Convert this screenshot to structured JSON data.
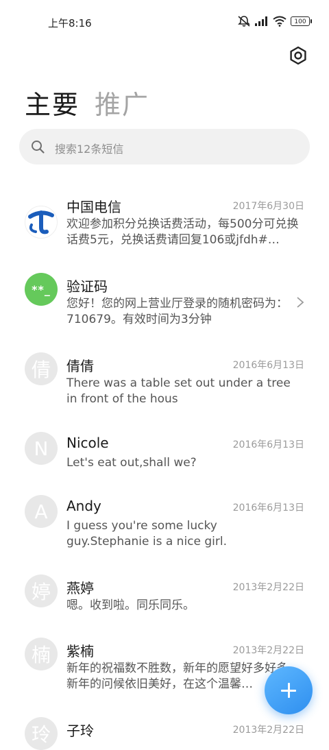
{
  "status": {
    "time": "上午8:16",
    "battery": "100"
  },
  "tabs": {
    "primary": "主要",
    "promotions": "推广"
  },
  "search": {
    "placeholder": "搜索12条短信"
  },
  "messages": [
    {
      "name": "中国电信",
      "date": "2017年6月30日",
      "preview": "欢迎参加积分兑换话费活动，每500分可兑换话费5元，兑换话费请回复106或jfdh#…",
      "avatar": "telecom-logo"
    },
    {
      "name": "验证码",
      "date": "",
      "preview": "您好！您的网上营业厅登录的随机密码为：710679。有效时间为3分钟",
      "avatar": "**_"
    },
    {
      "name": "倩倩",
      "date": "2016年6月13日",
      "preview": "There was a table set out under a tree in front of the hous",
      "avatar": "倩"
    },
    {
      "name": "Nicole",
      "date": "2016年6月13日",
      "preview": "Let's eat out,shall we?",
      "avatar": "N"
    },
    {
      "name": "Andy",
      "date": "2016年6月13日",
      "preview": "I guess you're some lucky guy.Stephanie is a nice girl.",
      "avatar": "A"
    },
    {
      "name": "燕婷",
      "date": "2013年2月22日",
      "preview": "嗯。收到啦。同乐同乐。",
      "avatar": "婷"
    },
    {
      "name": "紫楠",
      "date": "2013年2月22日",
      "preview": "新年的祝福数不胜数，新年的愿望好多好多，新年的问候依旧美好，在这个温馨…",
      "avatar": "楠"
    },
    {
      "name": "子玲",
      "date": "2013年2月22日",
      "preview": "",
      "avatar": "玲"
    }
  ],
  "icons": [
    "mute-icon",
    "signal-icon",
    "wifi-icon",
    "battery-icon",
    "settings-icon",
    "search-icon",
    "chevron-right-icon",
    "plus-icon"
  ],
  "colors": {
    "accent": "#2f8fef",
    "code_avatar": "#65c95b",
    "telecom": "#1b5dbb"
  }
}
